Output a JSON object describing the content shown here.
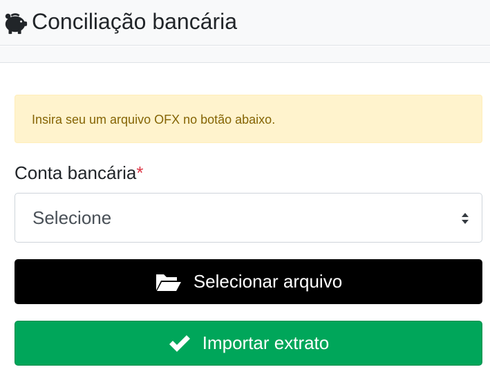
{
  "header": {
    "title": "Conciliação bancária",
    "icon": "piggy-bank-icon"
  },
  "alert": {
    "message": "Insira seu um arquivo OFX no botão abaixo."
  },
  "form": {
    "account_label": "Conta bancária",
    "required_mark": "*",
    "account_select": {
      "selected": "Selecione"
    }
  },
  "buttons": {
    "select_file": {
      "label": "Selecionar arquivo",
      "icon": "folder-open-icon"
    },
    "import": {
      "label": "Importar extrato",
      "icon": "check-icon"
    }
  },
  "colors": {
    "alert_bg": "#fff3cd",
    "alert_text": "#856404",
    "required": "#dc3545",
    "file_button_bg": "#000000",
    "import_button_bg": "#00a65a"
  }
}
